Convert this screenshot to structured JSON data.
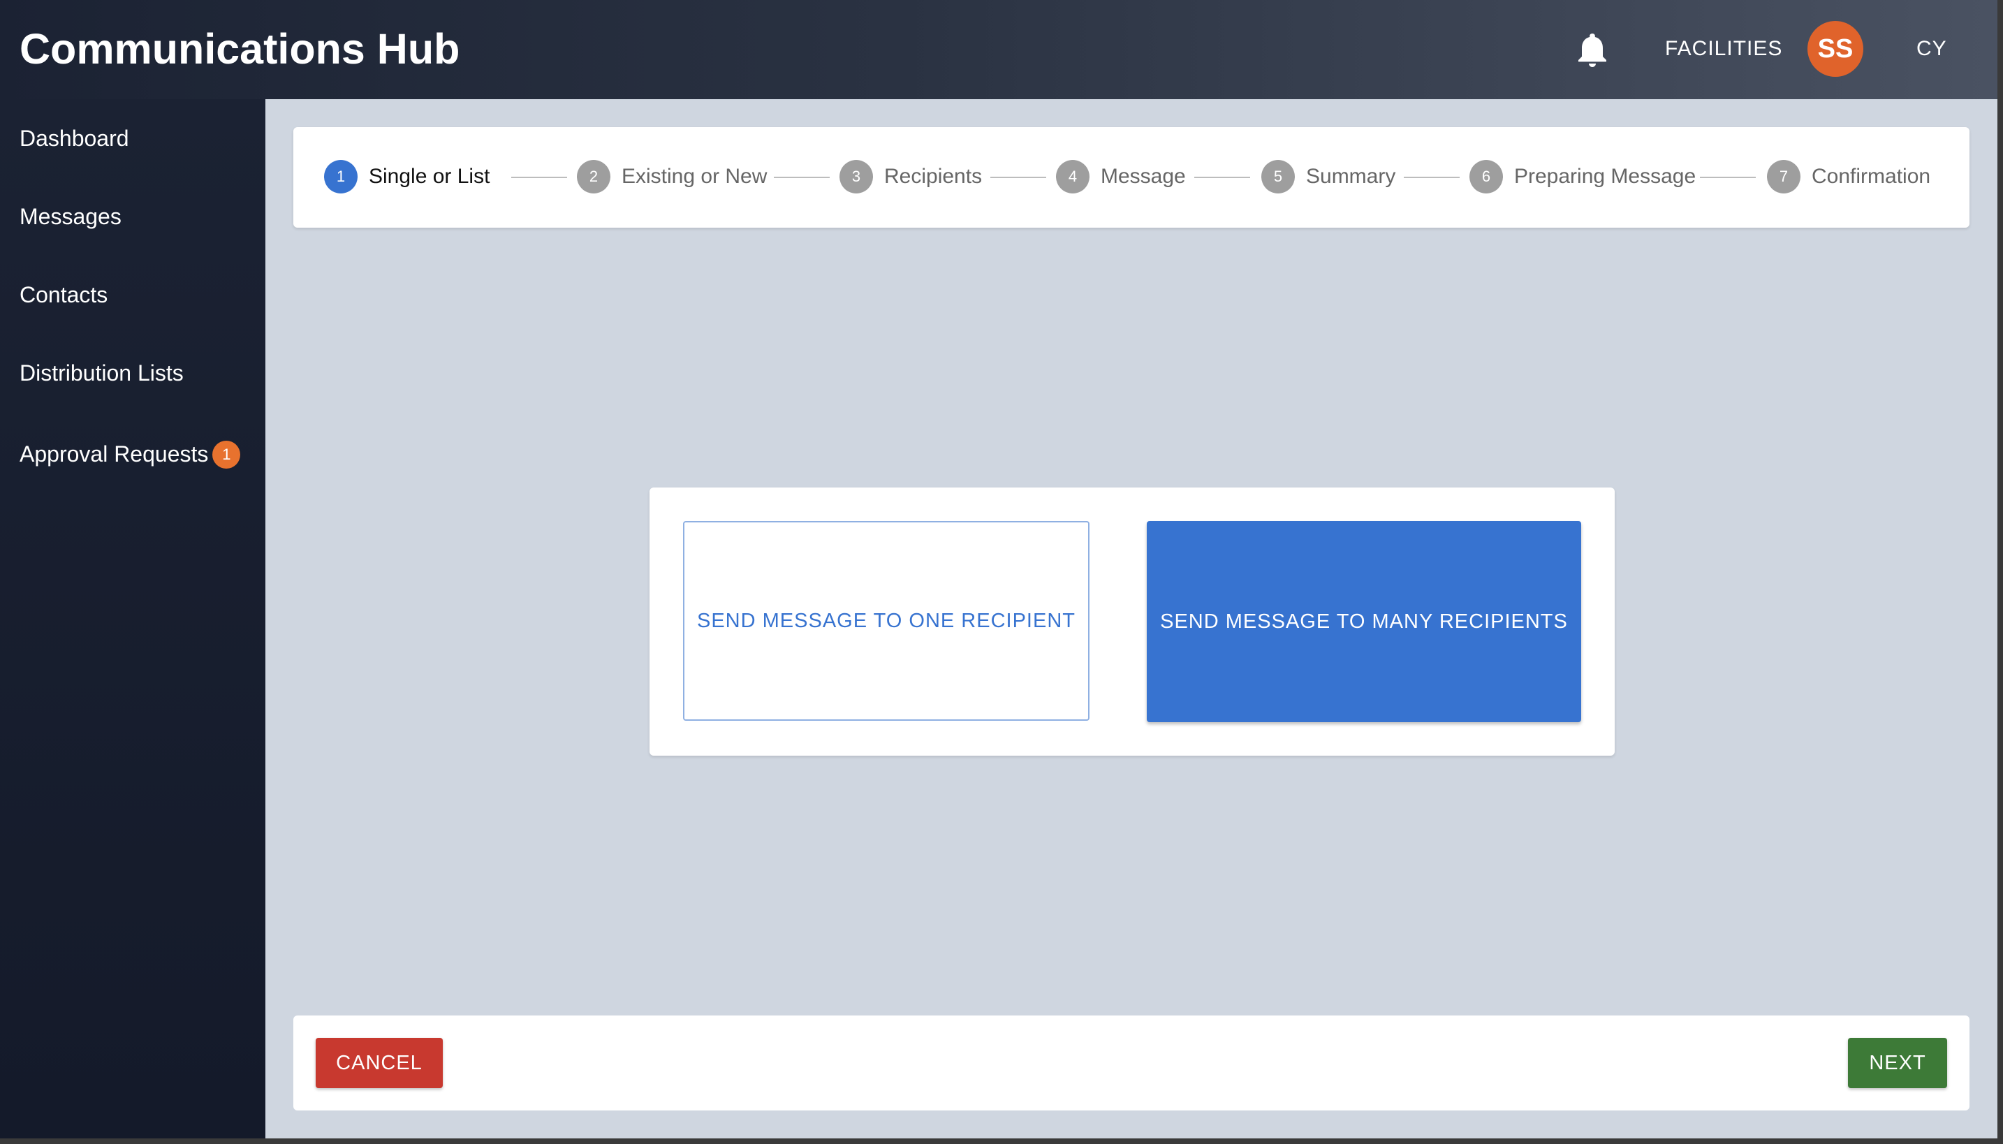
{
  "app": {
    "title": "Communications Hub"
  },
  "header": {
    "notifications_icon": "bell-icon",
    "facility_label": "FACILITIES",
    "avatar_initials": "SS",
    "user_initials": "CY"
  },
  "sidebar": {
    "items": [
      {
        "label": "Dashboard"
      },
      {
        "label": "Messages"
      },
      {
        "label": "Contacts"
      },
      {
        "label": "Distribution Lists"
      },
      {
        "label": "Approval Requests",
        "badge": "1"
      }
    ]
  },
  "stepper": {
    "active_step": 1,
    "steps": [
      {
        "number": "1",
        "label": "Single or List"
      },
      {
        "number": "2",
        "label": "Existing or New"
      },
      {
        "number": "3",
        "label": "Recipients"
      },
      {
        "number": "4",
        "label": "Message"
      },
      {
        "number": "5",
        "label": "Summary"
      },
      {
        "number": "6",
        "label": "Preparing Message"
      },
      {
        "number": "7",
        "label": "Confirmation"
      }
    ]
  },
  "choices": {
    "one_recipient_label": "SEND MESSAGE TO ONE RECIPIENT",
    "many_recipients_label": "SEND MESSAGE TO MANY RECIPIENTS"
  },
  "footer": {
    "cancel_label": "CANCEL",
    "next_label": "NEXT"
  },
  "colors": {
    "primary": "#3773d0",
    "cancel": "#c8392f",
    "next": "#3d7a37",
    "avatar": "#e0632b",
    "badge": "#e8722e"
  }
}
